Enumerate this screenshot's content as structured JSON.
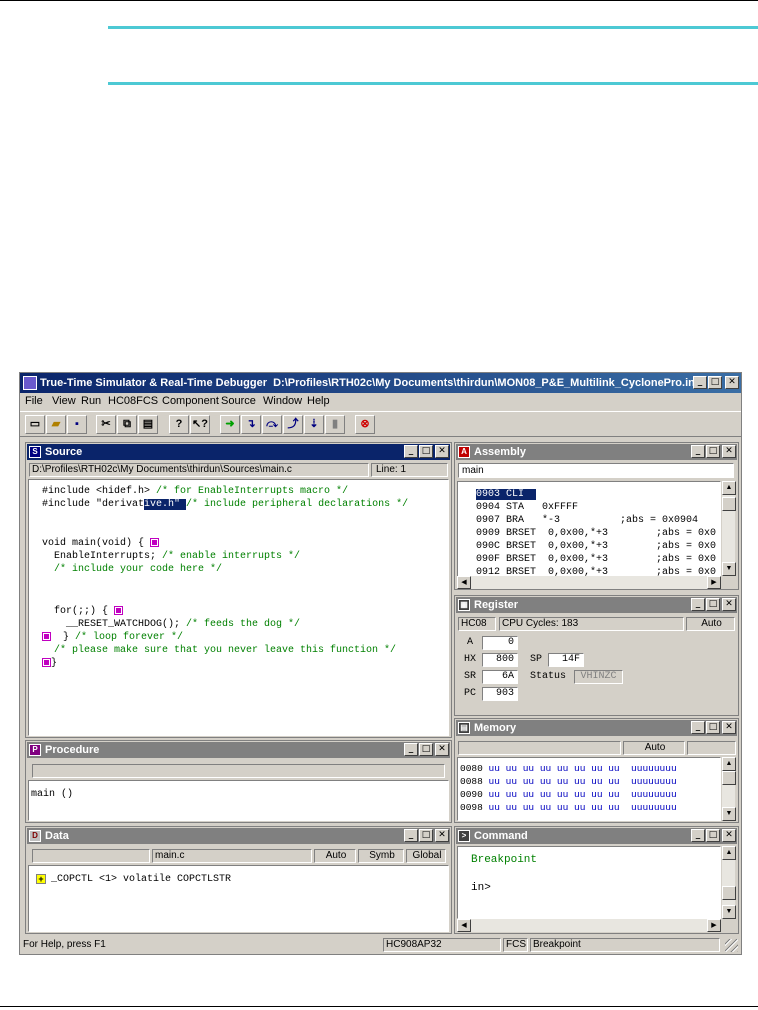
{
  "colors": {
    "rule": "#4dc9d4",
    "titlebar": "#0a246a",
    "inactive_title": "#808080",
    "comment": "#008000",
    "memory": "#0000c0",
    "breakpoint": "#c000c0"
  },
  "app": {
    "title": "True-Time Simulator & Real-Time Debugger",
    "project_path": "D:\\Profiles\\RTH02c\\My Documents\\thirdun\\MON08_P&E_Multilink_CyclonePro.ini"
  },
  "menu": [
    "File",
    "View",
    "Run",
    "HC08FCS",
    "Component",
    "Source",
    "Window",
    "Help"
  ],
  "toolbar": {
    "icons": [
      "new-icon",
      "open-icon",
      "save-icon",
      "cut-icon",
      "copy-icon",
      "paste-icon",
      "help-icon",
      "context-help-icon",
      "start-icon",
      "single-step-icon",
      "step-over-icon",
      "step-out-icon",
      "assembly-step-icon",
      "halt-icon",
      "reset-icon"
    ]
  },
  "source": {
    "title": "Source",
    "path": "D:\\Profiles\\RTH02c\\My Documents\\thirdun\\Sources\\main.c",
    "line": "Line: 1",
    "lines": [
      {
        "code": "#include <hidef.h>",
        "comment": " /* for EnableInterrupts macro */"
      },
      {
        "pre": "#include \"derivat",
        "sel": "ive.h\" ",
        "comment": "/* include peripheral declarations */"
      },
      {
        "code": "void main(void) {"
      },
      {
        "code": "  EnableInterrupts;",
        "comment": " /* enable interrupts */"
      },
      {
        "comment": "  /* include your code here */"
      },
      {
        "code": "  for(;;) {"
      },
      {
        "code": "    __RESET_WATCHDOG();",
        "comment": " /* feeds the dog */"
      },
      {
        "code": "  }",
        "comment": " /* loop forever */"
      },
      {
        "comment": "  /* please make sure that you never leave this function */"
      },
      {
        "code": "}"
      }
    ]
  },
  "procedure": {
    "title": "Procedure",
    "item": "main ()"
  },
  "data": {
    "title": "Data",
    "module": "main.c",
    "mode": "Auto",
    "format": "Symb",
    "scope": "Global",
    "var": "_COPCTL <1> volatile COPCTLSTR",
    "expand": "+"
  },
  "assembly": {
    "title": "Assembly",
    "header": "main",
    "rows": [
      {
        "text": "0903 CLI"
      },
      {
        "text": "0904 STA   0xFFFF"
      },
      {
        "text": "0907 BRA   *-3          ;abs = 0x0904"
      },
      {
        "text": "0909 BRSET  0,0x00,*+3        ;abs = 0x0"
      },
      {
        "text": "090C BRSET  0,0x00,*+3        ;abs = 0x0"
      },
      {
        "text": "090F BRSET  0,0x00,*+3        ;abs = 0x0"
      },
      {
        "text": "0912 BRSET  0,0x00,*+3        ;abs = 0x0"
      }
    ]
  },
  "register": {
    "title": "Register",
    "cpu": "HC08",
    "cycles": "CPU Cycles: 183",
    "mode": "Auto",
    "A": {
      "label": "A",
      "value": "0"
    },
    "HX": {
      "label": "HX",
      "value": "800"
    },
    "SP": {
      "label": "SP",
      "value": "14F"
    },
    "SR": {
      "label": "SR",
      "value": "6A"
    },
    "status": {
      "label": "Status",
      "value": "VHINZC"
    },
    "PC": {
      "label": "PC",
      "value": "903"
    }
  },
  "memory": {
    "title": "Memory",
    "mode": "Auto",
    "rows": [
      {
        "addr": "0080",
        "bytes": "uu uu uu uu uu uu uu uu",
        "ascii": "uuuuuuuu"
      },
      {
        "addr": "0088",
        "bytes": "uu uu uu uu uu uu uu uu",
        "ascii": "uuuuuuuu"
      },
      {
        "addr": "0090",
        "bytes": "uu uu uu uu uu uu uu uu",
        "ascii": "uuuuuuuu"
      },
      {
        "addr": "0098",
        "bytes": "uu uu uu uu uu uu uu uu",
        "ascii": "uuuuuuuu"
      }
    ]
  },
  "command": {
    "title": "Command",
    "output": "Breakpoint",
    "prompt": "in>"
  },
  "statusbar": {
    "help": "For Help, press F1",
    "chip": "HC908AP32",
    "conn": "FCS",
    "state": "Breakpoint"
  }
}
